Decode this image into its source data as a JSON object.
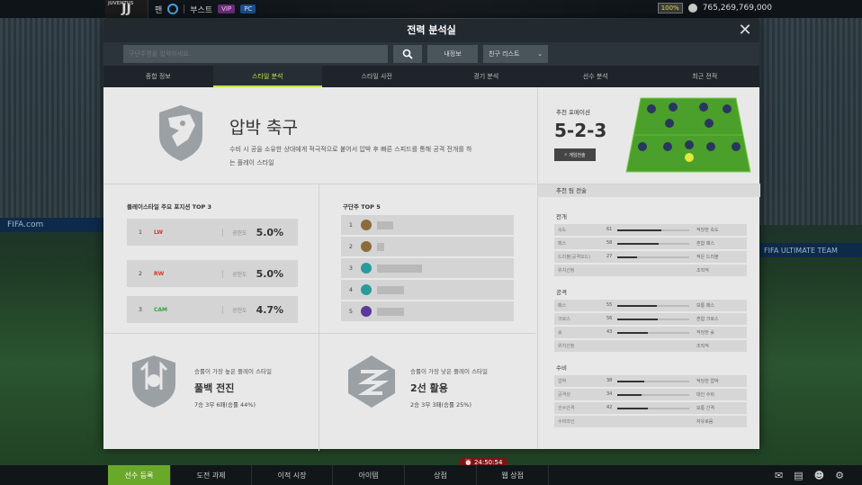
{
  "topbar": {
    "team_code": "JUVENTUS",
    "team_logo_text": "JJ",
    "menu": [
      "팬",
      "부스트"
    ],
    "vip": "VIP",
    "pc": "PC",
    "level_badge": "100%",
    "coins": "765,269,769,000"
  },
  "background": {
    "board_left": "FIFA.com",
    "board_right": "FIFA ULTIMATE TEAM"
  },
  "modal": {
    "title": "전력 분석실",
    "search_placeholder": "구단주명을 입력하세요.",
    "info_btn": "내정보",
    "friend_btn": "친구 리스트",
    "tabs": [
      "종합 정보",
      "스타일 분석",
      "스타일 사전",
      "경기 분석",
      "선수 분석",
      "최근 전적"
    ],
    "active_tab": 1
  },
  "hero": {
    "title": "압박 축구",
    "desc": "수비 시 공을 소유한 상대에게 적극적으로 붙어서 압박 후 빠른 스피드를 통해 공격 전개를 하는 플레이 스타일"
  },
  "positions": {
    "title": "플레이스타일 주요 포지션 TOP 3",
    "label": "공헌도",
    "rows": [
      {
        "rank": "1",
        "pos": "LW",
        "value": "5.0%",
        "color": "#d23a2a"
      },
      {
        "rank": "2",
        "pos": "RW",
        "value": "5.0%",
        "color": "#d23a2a"
      },
      {
        "rank": "3",
        "pos": "CAM",
        "value": "4.7%",
        "color": "#3aa03a"
      }
    ]
  },
  "clubs": {
    "title": "구단주 TOP 5",
    "rows": [
      {
        "rank": "1",
        "color": "#8a6d3a"
      },
      {
        "rank": "2",
        "color": "#8a6d3a"
      },
      {
        "rank": "3",
        "color": "#2a9a9a"
      },
      {
        "rank": "4",
        "color": "#2a9a9a"
      },
      {
        "rank": "5",
        "color": "#5a3a9a"
      }
    ]
  },
  "best_style": {
    "sub": "승률이 가장 높은 플레이 스타일",
    "name": "풀백 전진",
    "record": "7승 3무 6패(승률 44%)"
  },
  "worst_style": {
    "sub": "승률이 가장 낮은 플레이 스타일",
    "name": "2선 활용",
    "record": "2승 3무 3패(승률 25%)"
  },
  "formation": {
    "label": "추천 포메이션",
    "value": "5-2-3",
    "btn": "게임전술"
  },
  "tactics": {
    "title": "추천 팀 전술",
    "sections": [
      {
        "title": "전개",
        "rows": [
          {
            "name": "속도",
            "num": "61",
            "fill": 0.61,
            "desc": "적당한 속도"
          },
          {
            "name": "패스",
            "num": "58",
            "fill": 0.58,
            "desc": "혼합 패스"
          },
          {
            "name": "드리블(공격모드)",
            "num": "27",
            "fill": 0.27,
            "desc": "적은 드리블"
          },
          {
            "name": "위치선정",
            "num": "",
            "fill": 0,
            "desc": "조직적"
          }
        ]
      },
      {
        "title": "공격",
        "rows": [
          {
            "name": "패스",
            "num": "55",
            "fill": 0.55,
            "desc": "보통 패스"
          },
          {
            "name": "크로스",
            "num": "56",
            "fill": 0.56,
            "desc": "혼합 크로스"
          },
          {
            "name": "슛",
            "num": "43",
            "fill": 0.43,
            "desc": "적당한 슛"
          },
          {
            "name": "위치선정",
            "num": "",
            "fill": 0,
            "desc": "조직적"
          }
        ]
      },
      {
        "title": "수비",
        "rows": [
          {
            "name": "압박",
            "num": "38",
            "fill": 0.38,
            "desc": "적당한 압박"
          },
          {
            "name": "공격성",
            "num": "34",
            "fill": 0.34,
            "desc": "대인 수비"
          },
          {
            "name": "선수간격",
            "num": "42",
            "fill": 0.42,
            "desc": "보통 간격"
          },
          {
            "name": "수비라인",
            "num": "",
            "fill": 0,
            "desc": "자유로움"
          }
        ]
      }
    ]
  },
  "bottombar": {
    "items": [
      "선수 등록",
      "도전 과제",
      "이적 시장",
      "아이템",
      "상점",
      "웹 상점"
    ],
    "timer": "24:50:54"
  }
}
